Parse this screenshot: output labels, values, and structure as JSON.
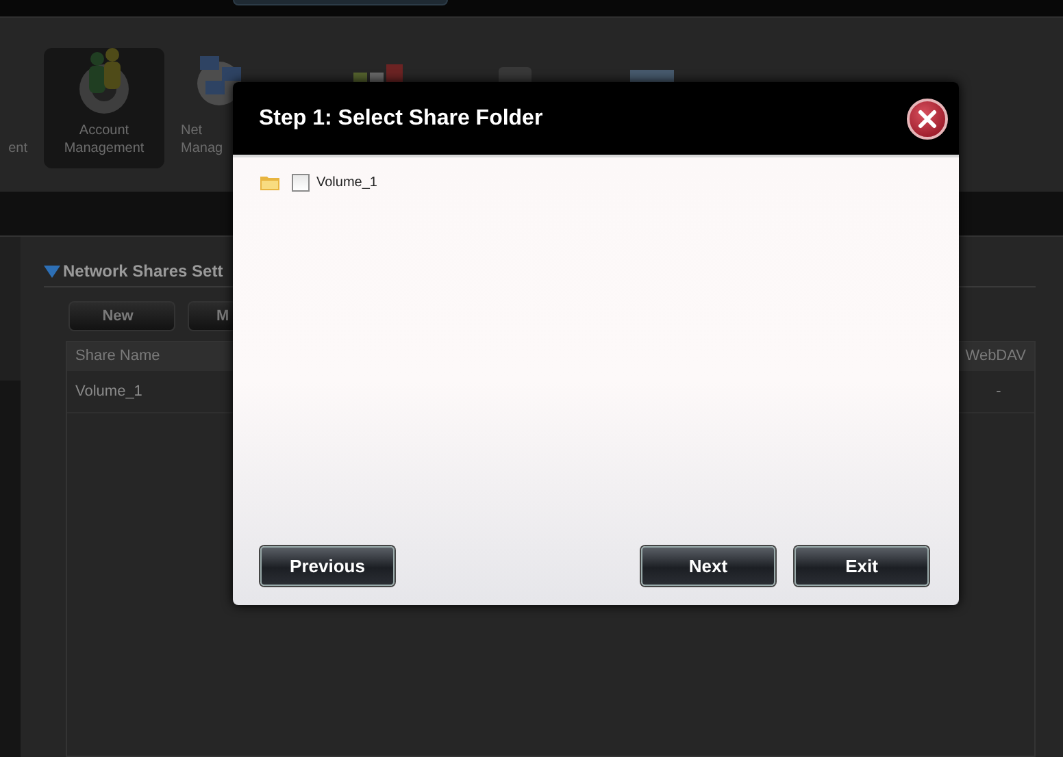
{
  "nav": {
    "items": [
      {
        "lines": [
          "ent"
        ],
        "selected": false
      },
      {
        "lines": [
          "Account",
          "Management"
        ],
        "selected": true
      },
      {
        "lines": [
          "Net",
          "Manag"
        ],
        "selected": false
      },
      {
        "selected": false
      },
      {
        "selected": false
      },
      {
        "selected": false
      }
    ]
  },
  "section": {
    "title": "Network Shares Sett",
    "buttons": [
      "New",
      "M"
    ],
    "table": {
      "columns": [
        "Share Name",
        "WebDAV"
      ],
      "rows": [
        [
          "Volume_1",
          "-"
        ]
      ]
    }
  },
  "dialog": {
    "title": "Step 1: Select Share Folder",
    "tree": [
      {
        "label": "Volume_1",
        "checked": false
      }
    ],
    "buttons": {
      "left": [
        "Previous"
      ],
      "right": [
        "Next",
        "Exit"
      ]
    }
  }
}
